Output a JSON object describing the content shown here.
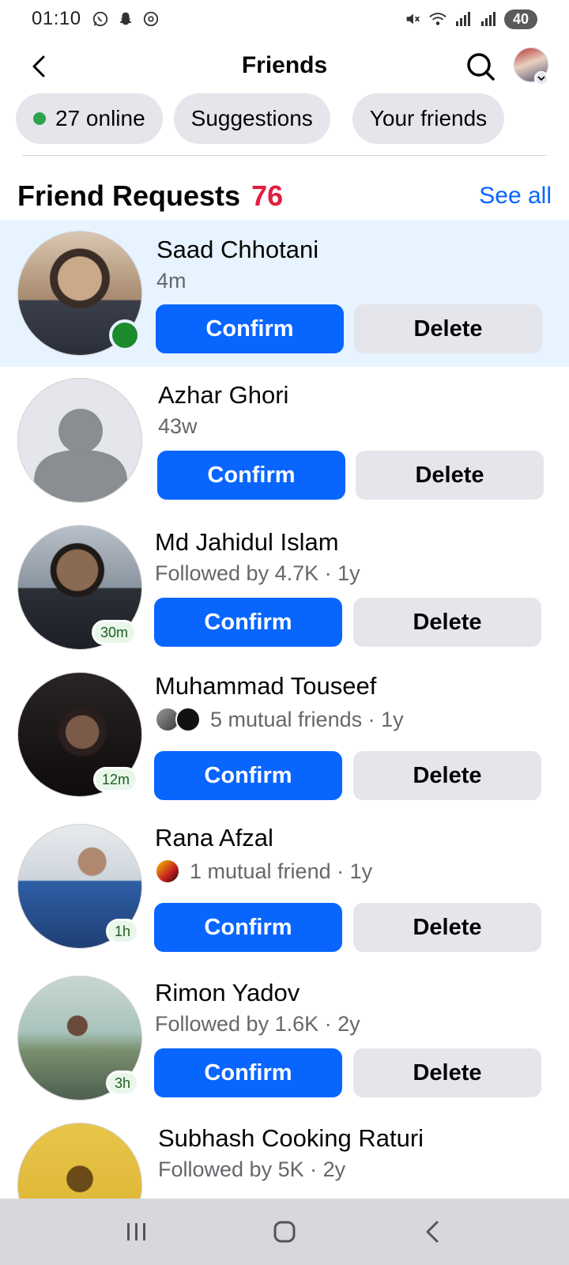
{
  "status_bar": {
    "time": "01:10",
    "battery": "40"
  },
  "header": {
    "title": "Friends"
  },
  "chips": [
    {
      "label": "27 online"
    },
    {
      "label": "Suggestions"
    },
    {
      "label": "Your friends"
    }
  ],
  "section": {
    "title": "Friend Requests",
    "count": "76",
    "see_all": "See all"
  },
  "buttons": {
    "confirm": "Confirm",
    "delete": "Delete"
  },
  "requests": [
    {
      "name": "Saad Chhotani",
      "meta": "4m",
      "online": true,
      "badge": "",
      "avatar_colors": [
        "#c9a98a",
        "#3a3f4a"
      ]
    },
    {
      "name": "Azhar Ghori",
      "meta": "43w",
      "online": false,
      "badge": "",
      "placeholder": true
    },
    {
      "name": "Md Jahidul Islam",
      "meta": "Followed by 4.7K · 1y",
      "badge": "30m",
      "avatar_colors": [
        "#8a94a0",
        "#2b2f36"
      ]
    },
    {
      "name": "Muhammad Touseef",
      "meta": "5 mutual friends · 1y",
      "badge": "12m",
      "mutual_icons": 2,
      "avatar_colors": [
        "#3a2a2a",
        "#0e0b0c"
      ]
    },
    {
      "name": "Rana Afzal",
      "meta": "1 mutual friend · 1y",
      "badge": "1h",
      "mutual_icons": 1,
      "avatar_colors": [
        "#dbe0e6",
        "#2f5fa5"
      ]
    },
    {
      "name": "Rimon Yadov",
      "meta": "Followed by 1.6K · 2y",
      "badge": "3h",
      "avatar_colors": [
        "#a9c3bd",
        "#4d5f50"
      ]
    },
    {
      "name": "Subhash Cooking Raturi",
      "meta": "Followed by 5K · 2y",
      "badge": "",
      "avatar_colors": [
        "#e0b93a",
        "#6a4b18"
      ]
    }
  ]
}
